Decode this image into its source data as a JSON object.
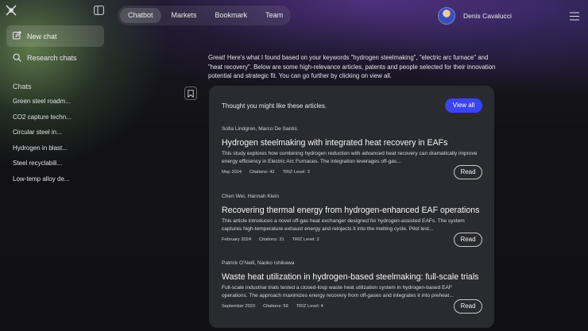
{
  "sidebar": {
    "new_chat": "New chat",
    "research_chats": "Research chats",
    "chats_heading": "Chats",
    "chats": [
      "Green steel roadm...",
      "CO2 capture techn...",
      "Circular steel in...",
      "Hydrogen in blast...",
      "Steel recyclabili...",
      "Low-temp alloy de..."
    ]
  },
  "nav": {
    "tabs": [
      "Chatbot",
      "Markets",
      "Bookmark",
      "Team"
    ],
    "active_tab": "Chatbot"
  },
  "user": {
    "name": "Denis Cavalucci"
  },
  "message": {
    "text": "Great! Here's what I found based on your keywords \"hydrogen steelmaking\", \"electric arc furnace\" and \"heat recovery\". Below are some high-relevance articles, patents and people selected for their innovation potential and strategic fit. You can go further by clicking on view all."
  },
  "panel": {
    "title": "Thought you might like these articles.",
    "view_all": "View all",
    "read_label": "Read",
    "articles": [
      {
        "authors": "Sofia Lindgren, Marco De Santis",
        "title": "Hydrogen steelmaking with integrated heat recovery in EAFs",
        "desc": "This study explores how combining hydrogen reduction with advanced heat recovery can dramatically improve energy efficiency in Electric Arc Furnaces. The integration leverages off-gas...",
        "date": "May 2024",
        "citations": "Citations: 42",
        "triz": "TRIZ Level: 3"
      },
      {
        "authors": "Chen Wei, Hannah Klein",
        "title": "Recovering thermal energy from hydrogen-enhanced EAF operations",
        "desc": "This article introduces a novel off-gas heat exchanger designed for hydrogen-assisted EAFs. The system captures high-temperature exhaust energy and reinjects it into the melting cycle. Pilot test...",
        "date": "February 2024",
        "citations": "Citations: 31",
        "triz": "TRIZ Level: 2"
      },
      {
        "authors": "Patrick O'Neill, Naoko Ishikawa",
        "title": "Waste heat utilization in hydrogen-based steelmaking: full-scale trials",
        "desc": "Full-scale industrial trials tested a closed-loop waste heat utilization system in hydrogen-based EAF operations. The approach maximizes energy recovery from off-gases and integrates it into preheat...",
        "date": "September 2023",
        "citations": "Citations: 59",
        "triz": "TRIZ Level: 4"
      }
    ]
  },
  "colors": {
    "accent": "#3a44f0",
    "panel_bg": "#2a2a31",
    "page_bg": "#111114"
  },
  "icons": [
    "logo-icon",
    "sidebar-toggle-icon",
    "edit-icon",
    "search-icon",
    "menu-icon",
    "bookmark-icon"
  ]
}
